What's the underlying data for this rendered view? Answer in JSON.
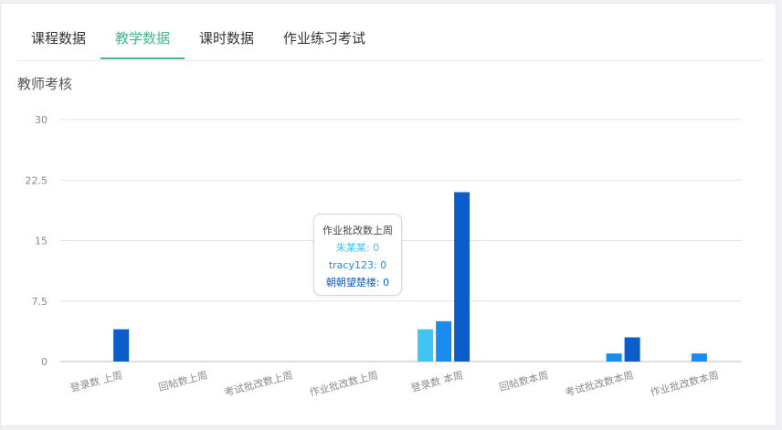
{
  "tabs": [
    {
      "label": "课程数据",
      "active": false
    },
    {
      "label": "教学数据",
      "active": true
    },
    {
      "label": "课时数据",
      "active": false
    },
    {
      "label": "作业练习考试",
      "active": false
    }
  ],
  "section_title": "教师考核",
  "colors": {
    "accent": "#3fb98a",
    "series": [
      "#3ec5f2",
      "#1a8cef",
      "#0b5ec9"
    ]
  },
  "tooltip": {
    "title": "作业批改数上周",
    "lines": [
      {
        "text": "朱某某: 0",
        "color": "#3ec5f2"
      },
      {
        "text": "tracy123: 0",
        "color": "#1a8cef"
      },
      {
        "text": "朝朝望楚楼: 0",
        "color": "#0b5ec9"
      }
    ]
  },
  "chart_data": {
    "type": "bar",
    "categories": [
      "登录数 上周",
      "回帖数上周",
      "考试批改数上周",
      "作业批改数上周",
      "登录数 本周",
      "回帖数本周",
      "考试批改数本周",
      "作业批改数本周"
    ],
    "series": [
      {
        "name": "朱某某",
        "values": [
          0,
          0,
          0,
          0,
          4,
          0,
          0,
          0
        ]
      },
      {
        "name": "tracy123",
        "values": [
          0,
          0,
          0,
          0,
          5,
          0,
          1,
          1
        ]
      },
      {
        "name": "朝朝望楚楼",
        "values": [
          4,
          0,
          0,
          0,
          21,
          0,
          3,
          0
        ]
      }
    ],
    "yticks": [
      "0",
      "7.5",
      "15",
      "22.5",
      "30"
    ],
    "ylim": [
      0,
      30
    ],
    "grid": true,
    "legend": "none"
  }
}
